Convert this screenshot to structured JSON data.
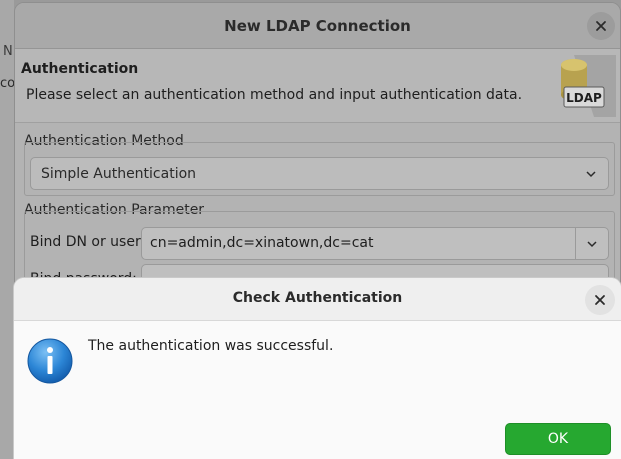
{
  "background": {
    "fragment_1": "N",
    "fragment_2": "co"
  },
  "main_dialog": {
    "title": "New LDAP Connection",
    "close_icon": "close-icon",
    "header": {
      "title": "Authentication",
      "description": "Please select an authentication method and input authentication data.",
      "logo_text": "LDAP"
    },
    "auth_method": {
      "group_label": "Authentication Method",
      "selected": "Simple Authentication"
    },
    "auth_params": {
      "group_label": "Authentication Parameter",
      "bind_dn_label": "Bind DN or user:",
      "bind_dn_value": "cn=admin,dc=xinatown,dc=cat",
      "bind_password_label": "Bind password:"
    }
  },
  "check_dialog": {
    "title": "Check Authentication",
    "message": "The authentication was successful.",
    "ok_label": "OK",
    "icon": "info-icon"
  },
  "colors": {
    "ok_button": "#26a830",
    "info_blue": "#1e73c8"
  }
}
